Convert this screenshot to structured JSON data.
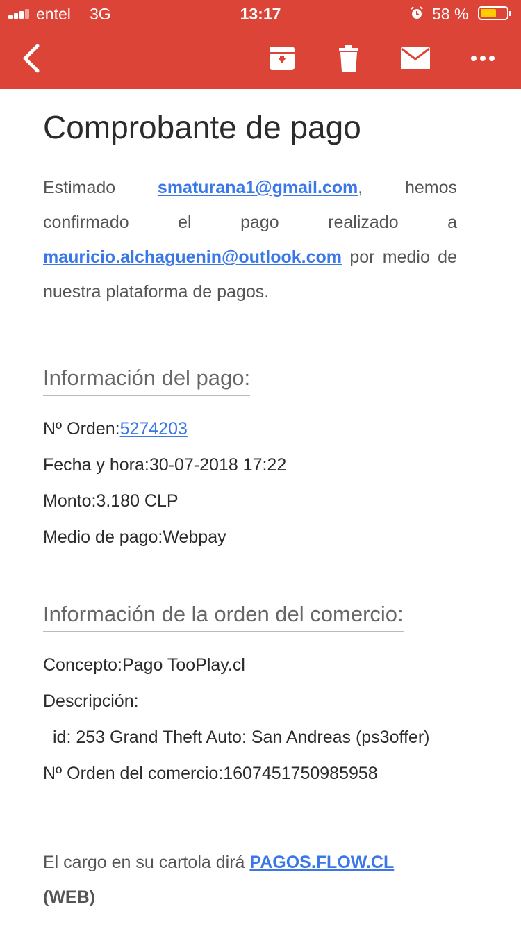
{
  "status_bar": {
    "carrier": "entel",
    "network": "3G",
    "time": "13:17",
    "battery": "58 %"
  },
  "toolbar": {
    "back_icon": "chevron-left-icon",
    "archive_icon": "archive-icon",
    "delete_icon": "trash-icon",
    "mark_unread_icon": "envelope-icon",
    "more_icon": "more-horizontal-icon",
    "color": "#db4437"
  },
  "email": {
    "title": "Comprobante de pago",
    "intro": {
      "part1": "Estimado ",
      "sender_email": "smaturana1@gmail.com",
      "part2": ", hemos confirmado el pago realizado a ",
      "recipient_email": "mauricio.alchaguenin@outlook.com",
      "part3": " por medio de nuestra plataforma de pagos."
    },
    "payment_info": {
      "heading": "Información del pago:",
      "order_label": "Nº Orden:",
      "order_number": "5274203",
      "datetime": "Fecha y hora:30-07-2018 17:22",
      "amount": "Monto:3.180 CLP",
      "method": "Medio de pago:Webpay"
    },
    "merchant_info": {
      "heading": "Información de la orden del comercio:",
      "concept": "Concepto:Pago TooPlay.cl",
      "description_label": "Descripción:",
      "description": "id: 253 Grand Theft Auto: San Andreas (ps3offer)",
      "merchant_order": "Nº Orden del comercio:1607451750985958"
    },
    "footer": {
      "text": "El cargo en su cartola dirá ",
      "link": "PAGOS.FLOW.CL",
      "suffix": "(WEB)"
    },
    "link_color": "#3b78e7"
  }
}
